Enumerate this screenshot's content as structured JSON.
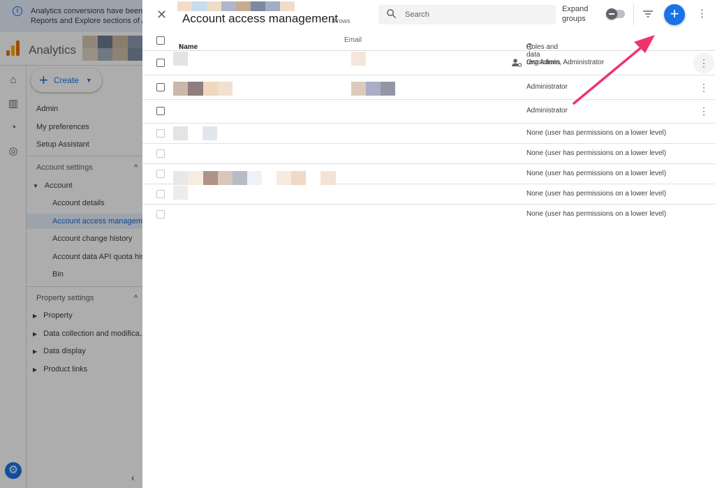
{
  "banner": {
    "text_line1": "Analytics conversions have been re",
    "text_line2": "Reports and Explore sections of An"
  },
  "app": {
    "title": "Analytics"
  },
  "create_button": {
    "label": "Create"
  },
  "sidebar": {
    "top_items": [
      "Admin",
      "My preferences",
      "Setup Assistant"
    ],
    "account_settings": {
      "header": "Account settings",
      "group": "Account",
      "items": [
        "Account details",
        "Account access managem...",
        "Account change history",
        "Account data API quota his...",
        "Bin"
      ]
    },
    "property_settings": {
      "header": "Property settings",
      "items": [
        "Property",
        "Data collection and modifica...",
        "Data display",
        "Product links"
      ]
    }
  },
  "panel": {
    "title": "Account access management",
    "row_count": "8 rows",
    "search_placeholder": "Search",
    "expand_groups_line1": "Expand",
    "expand_groups_line2": "groups",
    "columns": {
      "name": "Name",
      "sort_arrow": "↑",
      "email": "Email",
      "roles": "Roles and data restrictions"
    },
    "rows": [
      {
        "role": "Org Admin, Administrator"
      },
      {
        "role": "Administrator"
      },
      {
        "role": "Administrator"
      },
      {
        "role": "None (user has permissions on a lower level)"
      },
      {
        "role": "None (user has permissions on a lower level)"
      },
      {
        "role": "None (user has permissions on a lower level)"
      },
      {
        "role": "None (user has permissions on a lower level)"
      },
      {
        "role": "None (user has permissions on a lower level)"
      }
    ]
  },
  "colors": {
    "accent": "#1a73e8",
    "annotation_arrow": "#f0336b"
  }
}
